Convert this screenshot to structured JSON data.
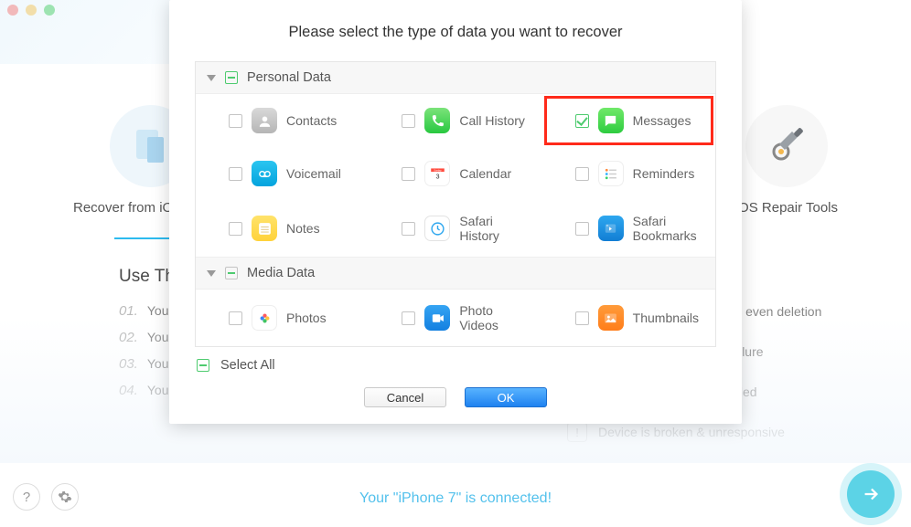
{
  "window": {
    "traffic_lights": [
      "close",
      "minimize",
      "zoom"
    ]
  },
  "modes": {
    "left_label": "Recover from iOS Device",
    "right_label": "iOS Repair Tools"
  },
  "left_panel": {
    "heading": "Use This Mode When:",
    "items": [
      {
        "num": "01.",
        "text": "Your device is working normally"
      },
      {
        "num": "02.",
        "text": "You've lost data and want to recover to a new device"
      },
      {
        "num": "03.",
        "text": "You don't have an iTunes or iCloud backup"
      },
      {
        "num": "04.",
        "text": "You want to preview before recovery"
      }
    ]
  },
  "right_panel": {
    "items": [
      "Accidentally deleted files, even deletion",
      "iOS upgrade, jailbreak failure",
      "Device is locked or disabled",
      "Device is broken & unresponsive"
    ]
  },
  "footer": {
    "status": "Your \"iPhone 7\" is connected!"
  },
  "modal": {
    "title": "Please select the type of data you want to recover",
    "categories": [
      {
        "label": "Personal Data",
        "items": [
          {
            "id": "contacts",
            "label": "Contacts",
            "icon": "contacts",
            "checked": false,
            "highlighted": false
          },
          {
            "id": "callhist",
            "label": "Call History",
            "icon": "call",
            "checked": false,
            "highlighted": false
          },
          {
            "id": "messages",
            "label": "Messages",
            "icon": "msg",
            "checked": true,
            "highlighted": true
          },
          {
            "id": "voicemail",
            "label": "Voicemail",
            "icon": "vm",
            "checked": false,
            "highlighted": false
          },
          {
            "id": "calendar",
            "label": "Calendar",
            "icon": "cal",
            "checked": false,
            "highlighted": false
          },
          {
            "id": "reminders",
            "label": "Reminders",
            "icon": "rem",
            "checked": false,
            "highlighted": false
          },
          {
            "id": "notes",
            "label": "Notes",
            "icon": "notes",
            "checked": false,
            "highlighted": false
          },
          {
            "id": "safhist",
            "label": "Safari History",
            "icon": "safh",
            "checked": false,
            "highlighted": false
          },
          {
            "id": "safbook",
            "label": "Safari Bookmarks",
            "icon": "safb",
            "checked": false,
            "highlighted": false
          }
        ]
      },
      {
        "label": "Media Data",
        "items": [
          {
            "id": "photos",
            "label": "Photos",
            "icon": "photos",
            "checked": false,
            "highlighted": false
          },
          {
            "id": "pvideos",
            "label": "Photo Videos",
            "icon": "pvideo",
            "checked": false,
            "highlighted": false
          },
          {
            "id": "thumbs",
            "label": "Thumbnails",
            "icon": "thumb",
            "checked": false,
            "highlighted": false
          }
        ]
      }
    ],
    "select_all": "Select All",
    "cancel": "Cancel",
    "ok": "OK"
  }
}
